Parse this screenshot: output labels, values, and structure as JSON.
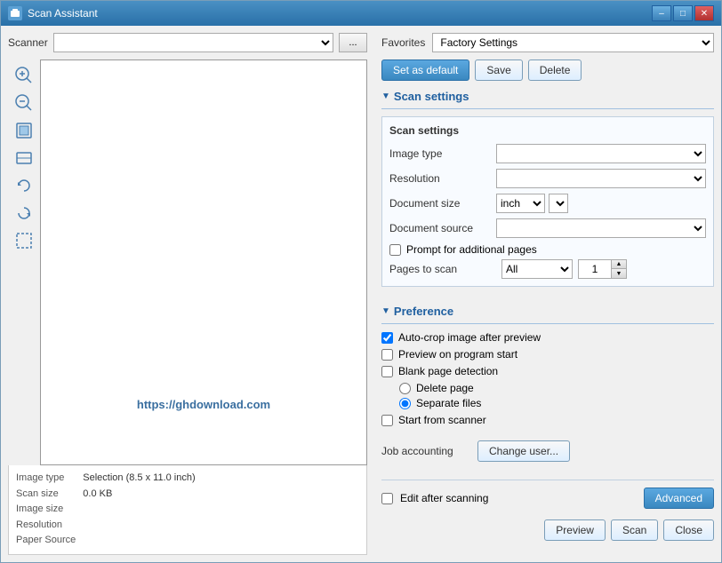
{
  "window": {
    "title": "Scan Assistant",
    "controls": {
      "minimize": "–",
      "restore": "□",
      "close": "✕"
    }
  },
  "left": {
    "scanner_label": "Scanner",
    "scanner_value": "",
    "browse_label": "...",
    "status": {
      "image_type_label": "Image type",
      "scan_size_label": "Scan size",
      "image_size_label": "Image size",
      "resolution_label": "Resolution",
      "paper_source_label": "Paper Source",
      "scan_size_value": "Selection (8.5 x 11.0 inch)",
      "image_size_value": "0.0 KB",
      "image_type_value": "",
      "resolution_value": "",
      "paper_source_value": ""
    }
  },
  "right": {
    "favorites_label": "Favorites",
    "favorites_value": "Factory Settings",
    "set_default_label": "Set as default",
    "save_label": "Save",
    "delete_label": "Delete",
    "scan_settings": {
      "section_title": "Scan settings",
      "group_title": "Scan settings",
      "image_type_label": "Image type",
      "resolution_label": "Resolution",
      "document_size_label": "Document size",
      "unit_value": "inch",
      "document_source_label": "Document source",
      "prompt_label": "Prompt for additional pages",
      "pages_to_scan_label": "Pages to scan",
      "pages_value": "All",
      "pages_number": "1"
    },
    "preference": {
      "section_title": "Preference",
      "auto_crop_label": "Auto-crop image after preview",
      "preview_start_label": "Preview on program start",
      "blank_detection_label": "Blank page detection",
      "delete_page_label": "Delete page",
      "separate_files_label": "Separate files",
      "start_scanner_label": "Start from scanner",
      "job_accounting_label": "Job accounting",
      "change_user_label": "Change user...",
      "edit_after_label": "Edit after scanning",
      "advanced_label": "Advanced"
    },
    "bottom": {
      "preview_label": "Preview",
      "scan_label": "Scan",
      "close_label": "Close"
    }
  },
  "watermark": "https://ghdownload.com"
}
